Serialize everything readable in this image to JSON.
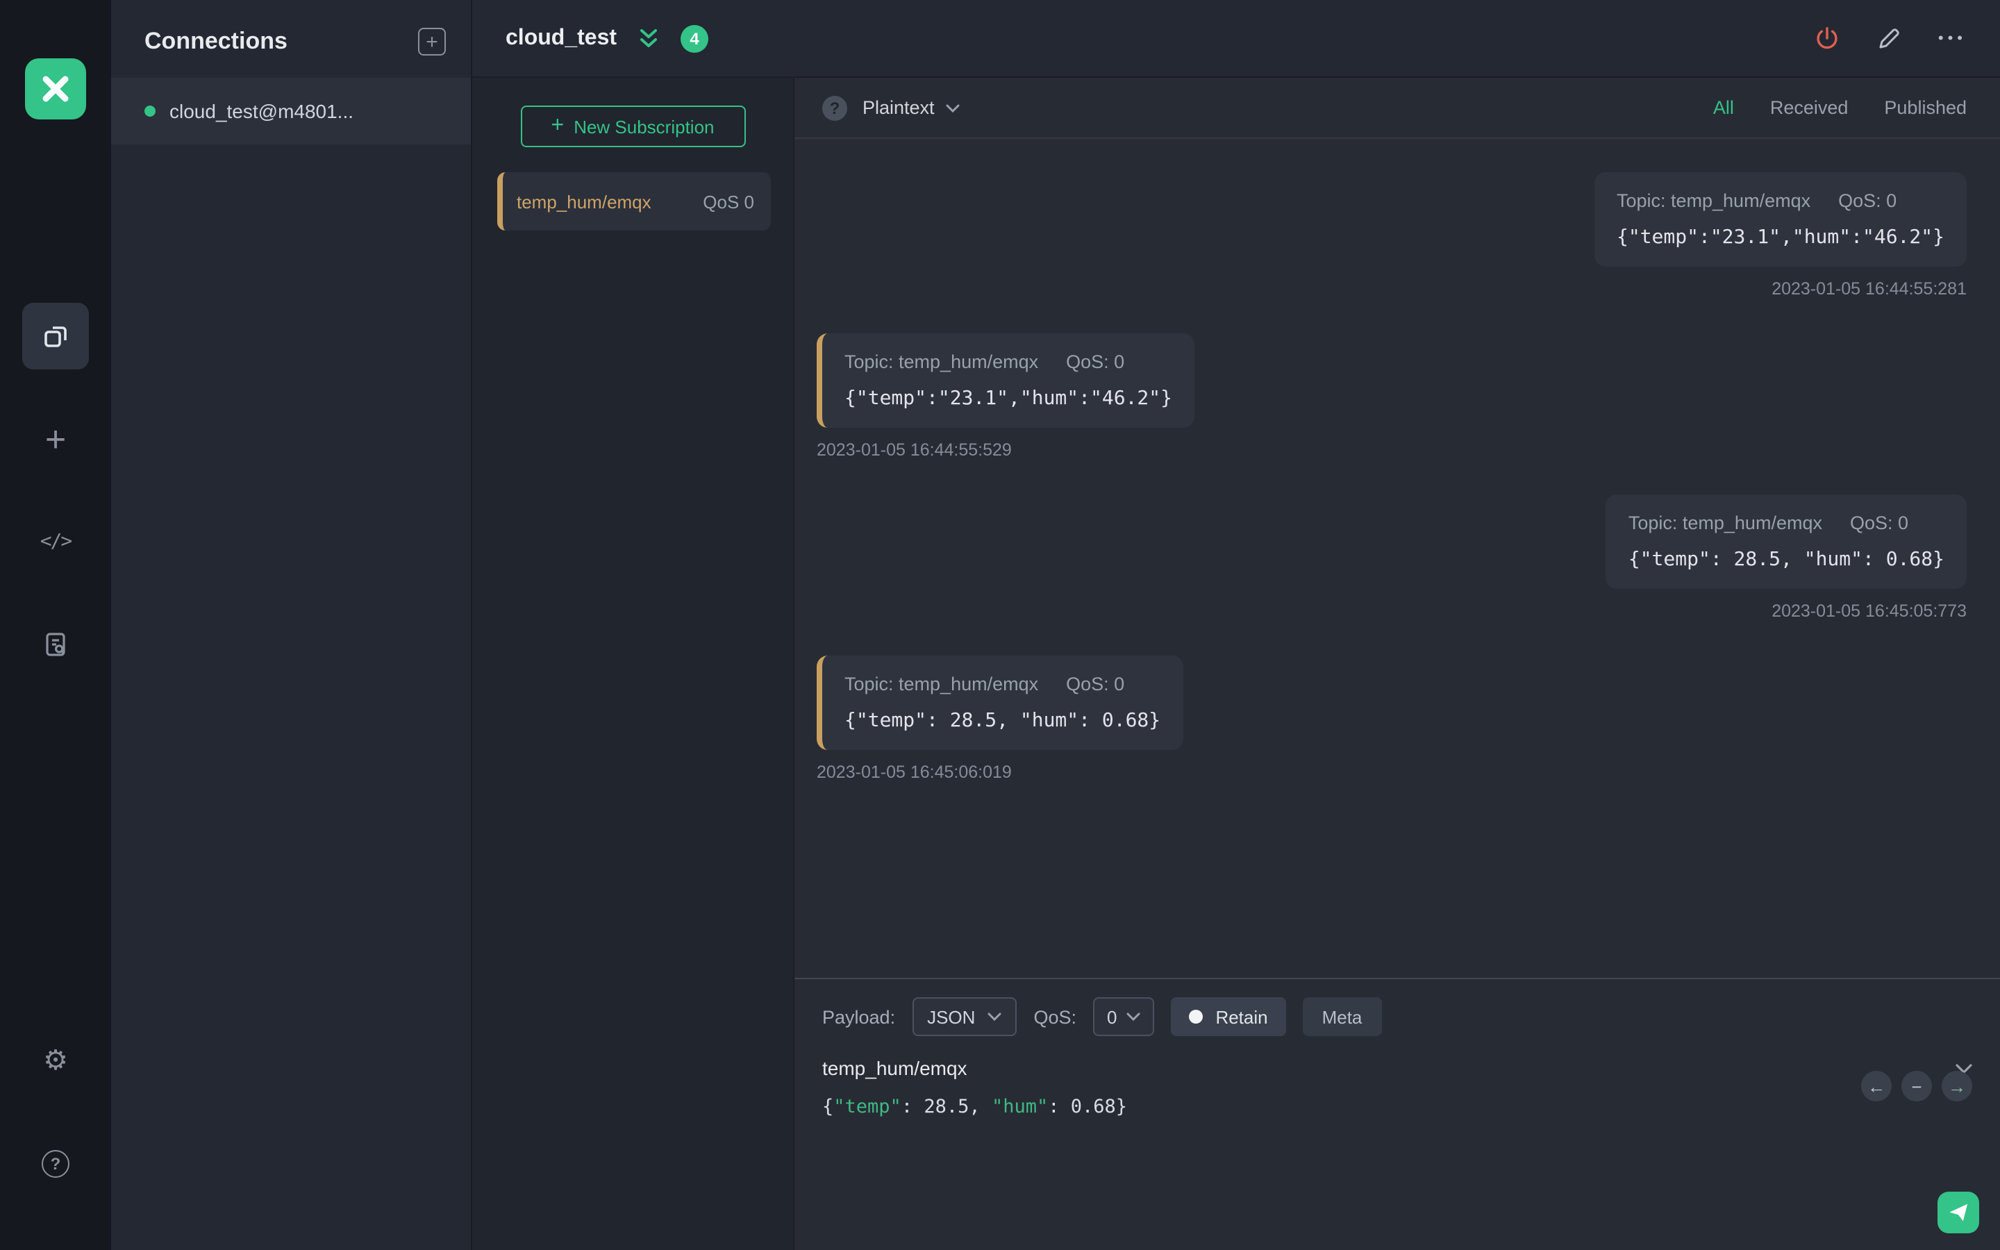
{
  "app": {
    "accent_color": "#34c388",
    "received_marker_color": "#c9a05f",
    "danger_color": "#e0604f"
  },
  "icons": {
    "rail_plus": "+",
    "rail_code": "</>",
    "gear": "⚙",
    "help": "?",
    "panel_plus": "+",
    "ellipsis": "•••",
    "toolbar_help": "?",
    "nav_back": "←",
    "nav_minus": "−",
    "nav_forward": "→",
    "new_sub_plus": "+"
  },
  "connections": {
    "title": "Connections",
    "items": [
      {
        "name": "cloud_test@m4801...",
        "status": "connected"
      }
    ]
  },
  "header": {
    "title": "cloud_test",
    "badge_count": "4"
  },
  "subscriptions": {
    "new_button_label": "New Subscription",
    "items": [
      {
        "topic": "temp_hum/emqx",
        "qos": "QoS 0"
      }
    ]
  },
  "messages": {
    "format_label": "Plaintext",
    "filters": [
      {
        "label": "All",
        "active": true
      },
      {
        "label": "Received",
        "active": false
      },
      {
        "label": "Published",
        "active": false
      }
    ],
    "items": [
      {
        "direction": "published",
        "topic": "Topic: temp_hum/emqx",
        "qos": "QoS: 0",
        "payload": "{\"temp\":\"23.1\",\"hum\":\"46.2\"}",
        "time": "2023-01-05 16:44:55:281"
      },
      {
        "direction": "received",
        "topic": "Topic: temp_hum/emqx",
        "qos": "QoS: 0",
        "payload": "{\"temp\":\"23.1\",\"hum\":\"46.2\"}",
        "time": "2023-01-05 16:44:55:529"
      },
      {
        "direction": "published",
        "topic": "Topic: temp_hum/emqx",
        "qos": "QoS: 0",
        "payload": "{\"temp\": 28.5, \"hum\": 0.68}",
        "time": "2023-01-05 16:45:05:773"
      },
      {
        "direction": "received",
        "topic": "Topic: temp_hum/emqx",
        "qos": "QoS: 0",
        "payload": "{\"temp\": 28.5, \"hum\": 0.68}",
        "time": "2023-01-05 16:45:06:019"
      }
    ]
  },
  "publish": {
    "payload_label": "Payload:",
    "payload_format": "JSON",
    "qos_label": "QoS:",
    "qos_value": "0",
    "retain_label": "Retain",
    "meta_label": "Meta",
    "topic_value": "temp_hum/emqx",
    "editor": [
      {
        "text": "{",
        "type": "punct"
      },
      {
        "text": "\"temp\"",
        "type": "key"
      },
      {
        "text": ": ",
        "type": "punct"
      },
      {
        "text": "28.5",
        "type": "number"
      },
      {
        "text": ", ",
        "type": "punct"
      },
      {
        "text": "\"hum\"",
        "type": "key"
      },
      {
        "text": ": ",
        "type": "punct"
      },
      {
        "text": "0.68",
        "type": "number"
      },
      {
        "text": "}",
        "type": "punct"
      }
    ]
  }
}
